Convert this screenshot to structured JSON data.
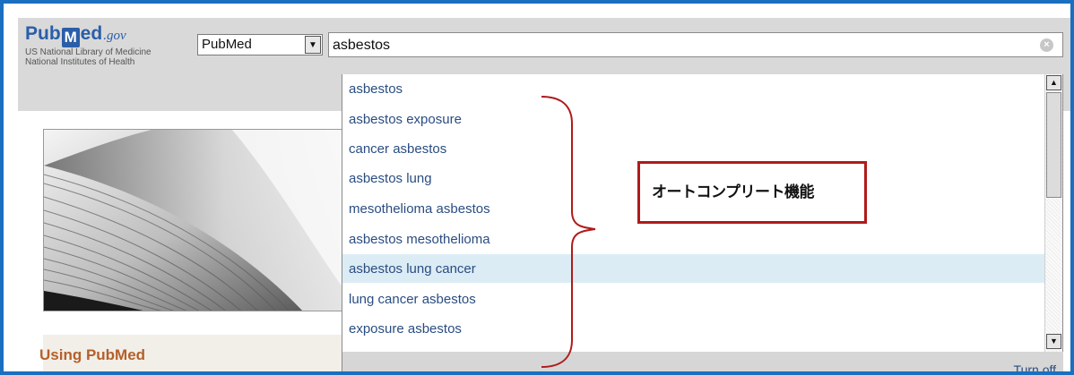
{
  "header": {
    "logo": {
      "pub": "Pub",
      "m": "M",
      "ed": "ed",
      "gov": ".gov"
    },
    "org_line1": "US National Library of Medicine",
    "org_line2": "National Institutes of Health",
    "database_select": "PubMed",
    "search_value": "asbestos"
  },
  "autocomplete": {
    "suggestions": [
      "asbestos",
      "asbestos exposure",
      "cancer asbestos",
      "asbestos lung",
      "mesothelioma asbestos",
      "asbestos mesothelioma",
      "asbestos lung cancer",
      "lung cancer asbestos",
      "exposure asbestos"
    ],
    "highlighted_index": 6,
    "turn_off": "Turn off"
  },
  "sidebar": {
    "using_title": "Using PubMed"
  },
  "annotation": {
    "callout_text": "オートコンプリート機能",
    "color": "#b01a1a"
  },
  "colors": {
    "frame": "#1a6fc0",
    "brand": "#2a5ea8",
    "highlight": "#dcecf4",
    "link": "#2a4d82"
  }
}
